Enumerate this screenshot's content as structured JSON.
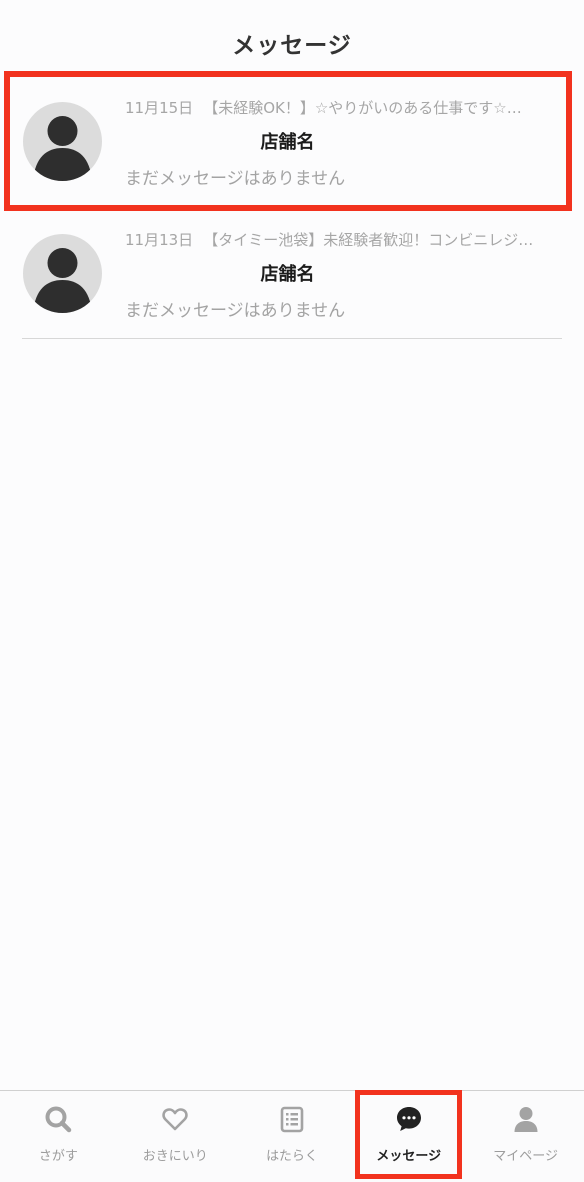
{
  "header": {
    "title": "メッセージ"
  },
  "threads": [
    {
      "date": "11月15日",
      "job_title": "【未経験OK！】☆やりがいのある仕事です☆…",
      "shop_name": "店舗名",
      "preview": "まだメッセージはありません",
      "avatar_icon": "person-icon",
      "highlighted": true
    },
    {
      "date": "11月13日",
      "job_title": "【タイミー池袋】未経験者歓迎！コンビニレジス…",
      "shop_name": "店舗名",
      "preview": "まだメッセージはありません",
      "avatar_icon": "person-icon",
      "highlighted": false
    }
  ],
  "tabbar": {
    "items": [
      {
        "label": "さがす",
        "icon": "search-icon",
        "active": false
      },
      {
        "label": "おきにいり",
        "icon": "heart-icon",
        "active": false
      },
      {
        "label": "はたらく",
        "icon": "clipboard-icon",
        "active": false
      },
      {
        "label": "メッセージ",
        "icon": "chat-bubble-icon",
        "active": true
      },
      {
        "label": "マイページ",
        "icon": "user-icon",
        "active": false
      }
    ]
  },
  "colors": {
    "highlight": "#f2321e",
    "inactive_icon": "#a3a3a3",
    "active_icon": "#222222",
    "avatar_bg": "#dcdcdc",
    "avatar_fg": "#2e2e2e"
  }
}
